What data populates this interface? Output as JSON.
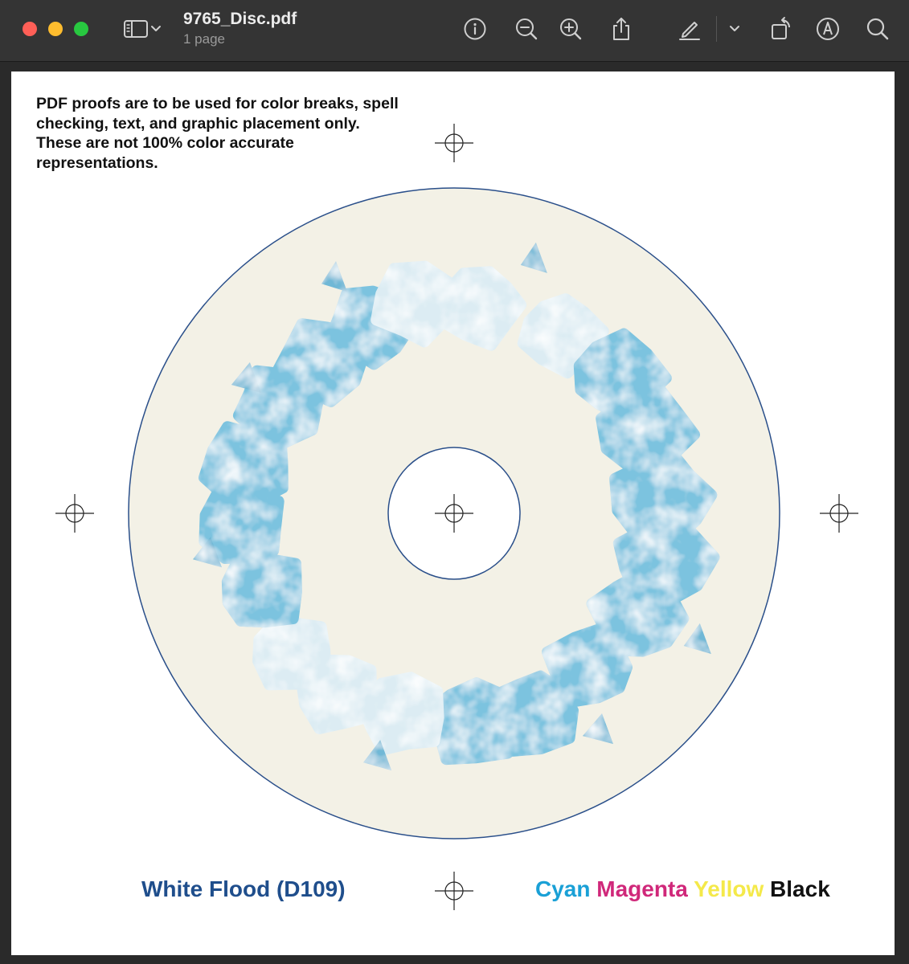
{
  "window": {
    "doc_title": "9765_Disc.pdf",
    "doc_subtitle": "1 page"
  },
  "toolbar": {
    "icons": [
      "sidebar-icon",
      "chevron-down-icon",
      "info-icon",
      "zoom-out-icon",
      "zoom-in-icon",
      "share-icon",
      "markup-pen-icon",
      "chevron-down-icon",
      "rotate-icon",
      "annotate-icon",
      "search-icon"
    ]
  },
  "page": {
    "disclaimer": "PDF proofs are to be used for color breaks, spell checking, text, and graphic placement only. These are not 100% color accurate representations.",
    "white_flood_label": "White Flood (D109)",
    "cmyk": {
      "cyan": "Cyan",
      "magenta": "Magenta",
      "yellow": "Yellow",
      "black": "Black"
    }
  },
  "colors": {
    "disc_fill": "#f3f1e6",
    "disc_outline": "#2a4f8a",
    "artwork_blue": "#7cc3df",
    "cyan": "#1aa0d6",
    "magenta": "#d0287a",
    "yellow": "#f4e94a",
    "black": "#111111",
    "white_flood_text": "#1f4e8c"
  }
}
